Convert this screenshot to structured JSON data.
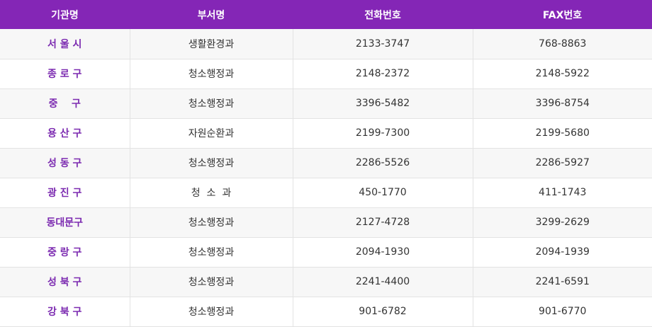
{
  "colors": {
    "header_bg": "#8426b6",
    "header_text": "#ffffff",
    "org_text": "#7b2ab0",
    "row_alt_bg": "#f7f7f7"
  },
  "table": {
    "headers": [
      "기관명",
      "부서명",
      "전화번호",
      "FAX번호"
    ],
    "rows": [
      [
        "서 울 시",
        "생활환경과",
        "2133-3747",
        "768-8863"
      ],
      [
        "종 로 구",
        "청소행정과",
        "2148-2372",
        "2148-5922"
      ],
      [
        "중    구",
        "청소행정과",
        "3396-5482",
        "3396-8754"
      ],
      [
        "용 산 구",
        "자원순환과",
        "2199-7300",
        "2199-5680"
      ],
      [
        "성 동 구",
        "청소행정과",
        "2286-5526",
        "2286-5927"
      ],
      [
        "광 진 구",
        "청  소  과",
        "450-1770",
        "411-1743"
      ],
      [
        "동대문구",
        "청소행정과",
        "2127-4728",
        "3299-2629"
      ],
      [
        "중 랑 구",
        "청소행정과",
        "2094-1930",
        "2094-1939"
      ],
      [
        "성 북 구",
        "청소행정과",
        "2241-4400",
        "2241-6591"
      ],
      [
        "강 북 구",
        "청소행정과",
        "901-6782",
        "901-6770"
      ]
    ]
  }
}
